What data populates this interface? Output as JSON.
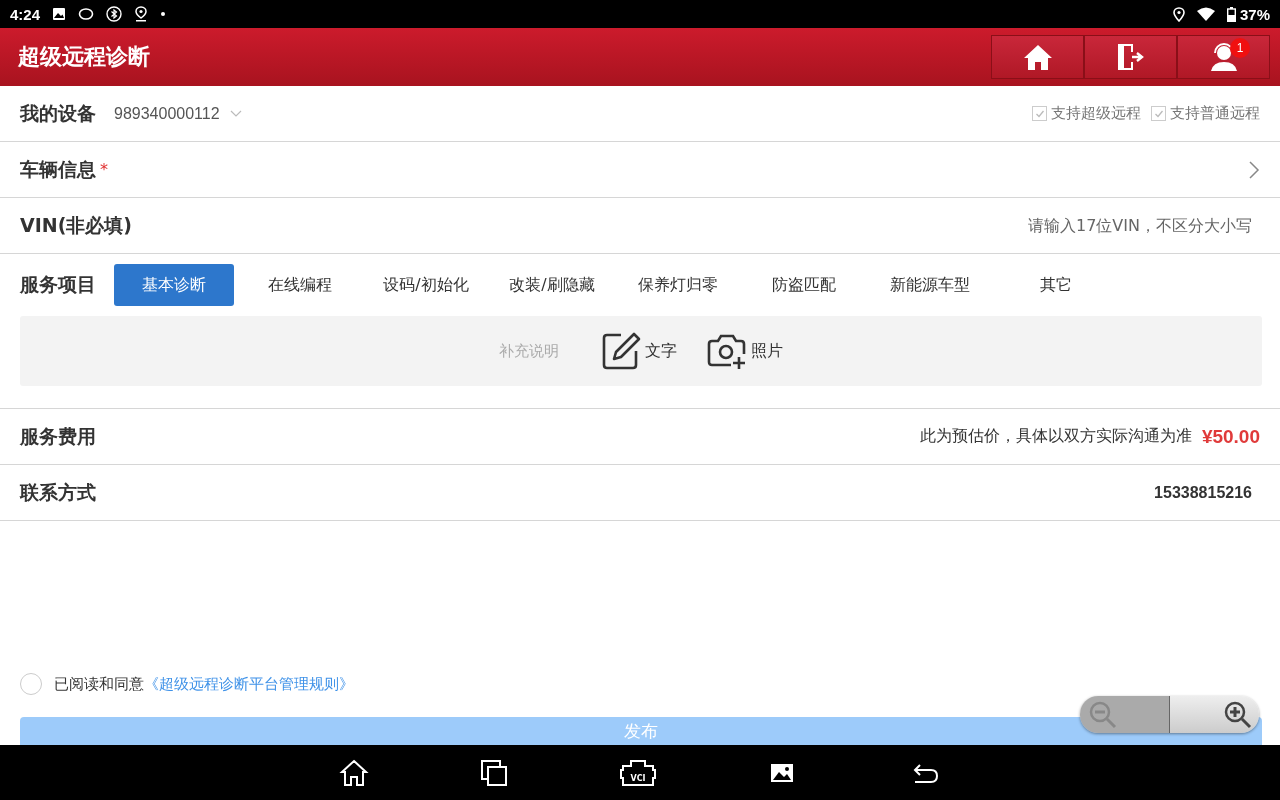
{
  "status_bar": {
    "time": "4:24",
    "battery": "37%"
  },
  "header": {
    "title": "超级远程诊断",
    "notification_count": "1"
  },
  "device": {
    "label": "我的设备",
    "value": "989340000112",
    "options": [
      {
        "label": "支持超级远程",
        "checked": true
      },
      {
        "label": "支持普通远程",
        "checked": true
      }
    ]
  },
  "vehicle": {
    "label": "车辆信息",
    "required_mark": "*"
  },
  "vin": {
    "label": "VIN(非必填)",
    "placeholder": "请输入17位VIN，不区分大小写"
  },
  "service": {
    "label": "服务项目",
    "tabs": [
      {
        "label": "基本诊断",
        "selected": true
      },
      {
        "label": "在线编程",
        "selected": false
      },
      {
        "label": "设码/初始化",
        "selected": false
      },
      {
        "label": "改装/刷隐藏",
        "selected": false
      },
      {
        "label": "保养灯归零",
        "selected": false
      },
      {
        "label": "防盗匹配",
        "selected": false
      },
      {
        "label": "新能源车型",
        "selected": false
      },
      {
        "label": "其它",
        "selected": false
      }
    ],
    "note": {
      "placeholder": "补充说明",
      "text_button": "文字",
      "photo_button": "照片"
    }
  },
  "fee": {
    "label": "服务费用",
    "note": "此为预估价，具体以双方实际沟通为准",
    "price": "¥50.00"
  },
  "contact": {
    "label": "联系方式",
    "value": "15338815216"
  },
  "agreement": {
    "checked": false,
    "text": "已阅读和同意",
    "link": "《超级远程诊断平台管理规则》"
  },
  "publish_button": "发布",
  "nav_bar": {
    "vci_label": "VCI"
  }
}
